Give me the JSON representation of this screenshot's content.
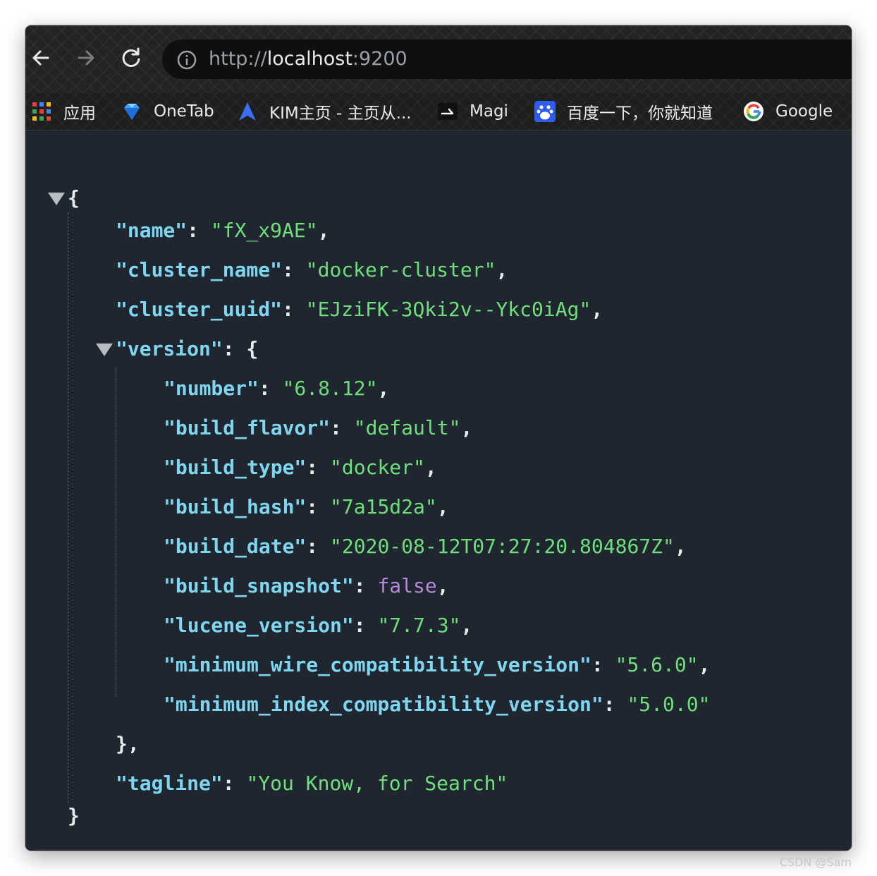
{
  "browser": {
    "url_scheme": "http://",
    "url_host": "localhost",
    "url_port": ":9200"
  },
  "bookmarks": [
    {
      "label": "应用",
      "icon": "apps-grid-icon"
    },
    {
      "label": "OneTab",
      "icon": "onetab-icon"
    },
    {
      "label": "KIM主页 - 主页从...",
      "icon": "kim-icon"
    },
    {
      "label": "Magi",
      "icon": "magi-icon"
    },
    {
      "label": "百度一下，你就知道",
      "icon": "baidu-icon"
    },
    {
      "label": "Google",
      "icon": "google-icon"
    }
  ],
  "json": {
    "open_brace": "{",
    "close_brace": "}",
    "name_key": "\"name\"",
    "name_val": "\"fX_x9AE\"",
    "cluster_name_key": "\"cluster_name\"",
    "cluster_name_val": "\"docker-cluster\"",
    "cluster_uuid_key": "\"cluster_uuid\"",
    "cluster_uuid_val": "\"EJziFK-3Qki2v--Ykc0iAg\"",
    "version_key": "\"version\"",
    "version_close": "},",
    "version": [
      {
        "key": "\"number\"",
        "val": "\"6.8.12\"",
        "type": "str",
        "comma": ","
      },
      {
        "key": "\"build_flavor\"",
        "val": "\"default\"",
        "type": "str",
        "comma": ","
      },
      {
        "key": "\"build_type\"",
        "val": "\"docker\"",
        "type": "str",
        "comma": ","
      },
      {
        "key": "\"build_hash\"",
        "val": "\"7a15d2a\"",
        "type": "str",
        "comma": ","
      },
      {
        "key": "\"build_date\"",
        "val": "\"2020-08-12T07:27:20.804867Z\"",
        "type": "str",
        "comma": ","
      },
      {
        "key": "\"build_snapshot\"",
        "val": "false",
        "type": "bool",
        "comma": ","
      },
      {
        "key": "\"lucene_version\"",
        "val": "\"7.7.3\"",
        "type": "str",
        "comma": ","
      },
      {
        "key": "\"minimum_wire_compatibility_version\"",
        "val": "\"5.6.0\"",
        "type": "str",
        "comma": ","
      },
      {
        "key": "\"minimum_index_compatibility_version\"",
        "val": "\"5.0.0\"",
        "type": "str",
        "comma": ""
      }
    ],
    "tagline_key": "\"tagline\"",
    "tagline_val": "\"You Know, for Search\""
  },
  "watermark": "CSDN @Sam"
}
